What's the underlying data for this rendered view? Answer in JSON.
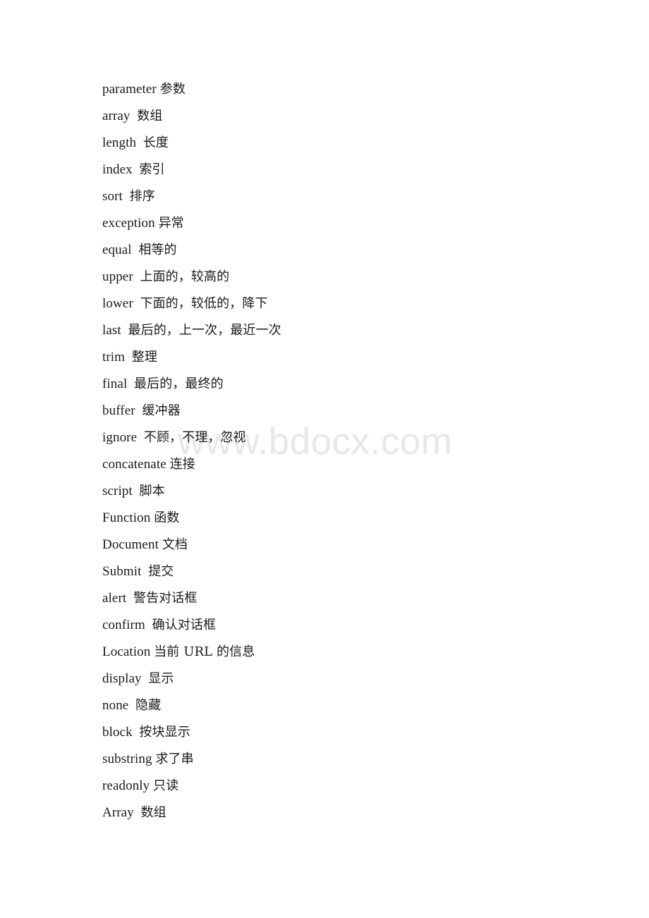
{
  "document": {
    "type": "vocabulary-glossary",
    "background_color": "#ffffff",
    "text_color": "#1a1a1a"
  },
  "watermark": {
    "text": "www.bdocx.com",
    "color": "#e8e8e8"
  },
  "vocabulary": [
    {
      "term": "parameter",
      "separator": " ",
      "gloss": "参数"
    },
    {
      "term": "array",
      "separator": "  ",
      "gloss": "数组"
    },
    {
      "term": "length",
      "separator": "  ",
      "gloss": "长度"
    },
    {
      "term": "index",
      "separator": "  ",
      "gloss": "索引"
    },
    {
      "term": "sort",
      "separator": "  ",
      "gloss": "排序"
    },
    {
      "term": "exception",
      "separator": " ",
      "gloss": "异常"
    },
    {
      "term": "equal",
      "separator": "  ",
      "gloss": "相等的"
    },
    {
      "term": "upper",
      "separator": "  ",
      "gloss": "上面的，较高的"
    },
    {
      "term": "lower",
      "separator": "  ",
      "gloss": "下面的，较低的，降下"
    },
    {
      "term": "last",
      "separator": "  ",
      "gloss": "最后的，上一次，最近一次"
    },
    {
      "term": "trim",
      "separator": "  ",
      "gloss": "整理"
    },
    {
      "term": "final",
      "separator": "  ",
      "gloss": "最后的，最终的"
    },
    {
      "term": "buffer",
      "separator": "  ",
      "gloss": "缓冲器"
    },
    {
      "term": "ignore",
      "separator": "  ",
      "gloss": "不顾，不理，忽视"
    },
    {
      "term": "concatenate",
      "separator": " ",
      "gloss": "连接"
    },
    {
      "term": "script",
      "separator": "  ",
      "gloss": "脚本"
    },
    {
      "term": "Function",
      "separator": " ",
      "gloss": "函数"
    },
    {
      "term": "Document",
      "separator": " ",
      "gloss": "文档"
    },
    {
      "term": "Submit",
      "separator": "  ",
      "gloss": "提交"
    },
    {
      "term": "alert",
      "separator": "  ",
      "gloss": "警告对话框"
    },
    {
      "term": "confirm",
      "separator": "  ",
      "gloss": "确认对话框"
    },
    {
      "term": "Location",
      "separator": " ",
      "gloss": "当前 URL 的信息"
    },
    {
      "term": "display",
      "separator": "  ",
      "gloss": "显示"
    },
    {
      "term": "none",
      "separator": "  ",
      "gloss": "隐藏"
    },
    {
      "term": "block",
      "separator": "  ",
      "gloss": "按块显示"
    },
    {
      "term": "substring",
      "separator": " ",
      "gloss": "求了串"
    },
    {
      "term": "readonly",
      "separator": " ",
      "gloss": "只读"
    },
    {
      "term": "Array",
      "separator": "  ",
      "gloss": "数组"
    }
  ]
}
